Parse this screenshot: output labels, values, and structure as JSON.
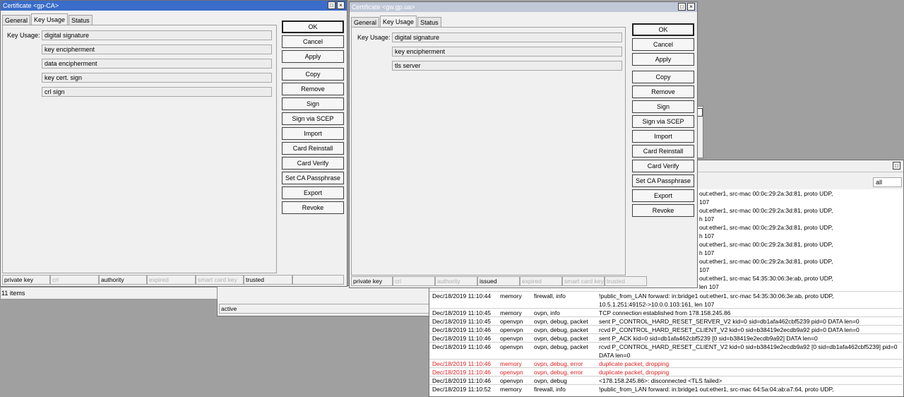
{
  "win1": {
    "title": "Certificate <gp-CA>",
    "tabs": [
      "General",
      "Key Usage",
      "Status"
    ],
    "key_usage_label": "Key Usage:",
    "key_usage": [
      "digital signature",
      "key encipherment",
      "data encipherment",
      "key cert. sign",
      "crl sign"
    ],
    "buttons": [
      "OK",
      "Cancel",
      "Apply",
      "Copy",
      "Remove",
      "Sign",
      "Sign via SCEP",
      "Import",
      "Card Reinstall",
      "Card Verify",
      "Set CA Passphrase",
      "Export",
      "Revoke"
    ],
    "status": [
      "private key",
      "crl",
      "authority",
      "expired",
      "smart card key",
      "trusted",
      ""
    ]
  },
  "win2": {
    "title": "Certificate <gw.gp.ua>",
    "tabs": [
      "General",
      "Key Usage",
      "Status"
    ],
    "key_usage_label": "Key Usage:",
    "key_usage": [
      "digital signature",
      "key encipherment",
      "tls server"
    ],
    "buttons": [
      "OK",
      "Cancel",
      "Apply",
      "Copy",
      "Remove",
      "Sign",
      "Sign via SCEP",
      "Import",
      "Card Reinstall",
      "Card Verify",
      "Set CA Passphrase",
      "Export",
      "Revoke"
    ],
    "status": [
      "private key",
      "crl",
      "authority",
      "issued",
      "expired",
      "smart card key",
      "trusted"
    ]
  },
  "background": {
    "items_count": "11 items",
    "active_status": "active"
  },
  "log": {
    "filter_value": "all",
    "fragments": [
      "out:ether1, src-mac 00:0c:29:2a:3d:81, proto UDP,",
      "107",
      "out:ether1, src-mac 00:0c:29:2a:3d:81, proto UDP,",
      "h 107",
      "out:ether1, src-mac 00:0c:29:2a:3d:81, proto UDP,",
      "h 107",
      "out:ether1, src-mac 00:0c:29:2a:3d:81, proto UDP,",
      "h 107",
      "out:ether1, src-mac 00:0c:29:2a:3d:81, proto UDP,",
      "107",
      "out:ether1, src-mac 54:35:30:06:3e:ab, proto UDP,",
      "len 107"
    ],
    "rows": [
      {
        "time": "Dec/18/2019 11:10:44",
        "buffer": "memory",
        "topics": "firewall, info",
        "message": "!public_from_LAN forward: in:bridge1 out:ether1, src-mac 54:35:30:06:3e:ab, proto UDP,",
        "cont": "10.5.1.251:49152->10.0.0.103:161, len 107",
        "error": false
      },
      {
        "time": "Dec/18/2019 11:10:45",
        "buffer": "memory",
        "topics": "ovpn, info",
        "message": "TCP connection established from 178.158.245.86",
        "cont": "",
        "error": false
      },
      {
        "time": "Dec/18/2019 11:10:45",
        "buffer": "openvpn",
        "topics": "ovpn, debug, packet",
        "message": "sent P_CONTROL_HARD_RESET_SERVER_V2 kid=0 sid=db1afa462cbf5239 pid=0 DATA len=0",
        "cont": "",
        "error": false
      },
      {
        "time": "Dec/18/2019 11:10:46",
        "buffer": "openvpn",
        "topics": "ovpn, debug, packet",
        "message": "rcvd P_CONTROL_HARD_RESET_CLIENT_V2 kid=0 sid=b38419e2ecdb9a92 pid=0 DATA len=0",
        "cont": "",
        "error": false
      },
      {
        "time": "Dec/18/2019 11:10:46",
        "buffer": "openvpn",
        "topics": "ovpn, debug, packet",
        "message": "sent P_ACK kid=0 sid=db1afa462cbf5239 [0 sid=b38419e2ecdb9a92] DATA len=0",
        "cont": "",
        "error": false
      },
      {
        "time": "Dec/18/2019 11:10:46",
        "buffer": "openvpn",
        "topics": "ovpn, debug, packet",
        "message": "rcvd P_CONTROL_HARD_RESET_CLIENT_V2 kid=0 sid=b38419e2ecdb9a92 [0 sid=db1afa462cbf5239] pid=0",
        "cont": "DATA len=0",
        "error": false
      },
      {
        "time": "Dec/18/2019 11:10:46",
        "buffer": "memory",
        "topics": "ovpn, debug, error",
        "message": "duplicate packet, dropping",
        "cont": "",
        "error": true
      },
      {
        "time": "Dec/18/2019 11:10:46",
        "buffer": "openvpn",
        "topics": "ovpn, debug, error",
        "message": "duplicate packet, dropping",
        "cont": "",
        "error": true
      },
      {
        "time": "Dec/18/2019 11:10:46",
        "buffer": "openvpn",
        "topics": "ovpn, debug",
        "message": "<178.158.245.86>: disconnected <TLS failed>",
        "cont": "",
        "error": false
      },
      {
        "time": "Dec/18/2019 11:10:52",
        "buffer": "memory",
        "topics": "firewall, info",
        "message": "!public_from_LAN forward: in:bridge1 out:ether1, src-mac 64:5a:04:ab:a7:64, proto UDP,",
        "cont": "",
        "error": false
      }
    ]
  }
}
